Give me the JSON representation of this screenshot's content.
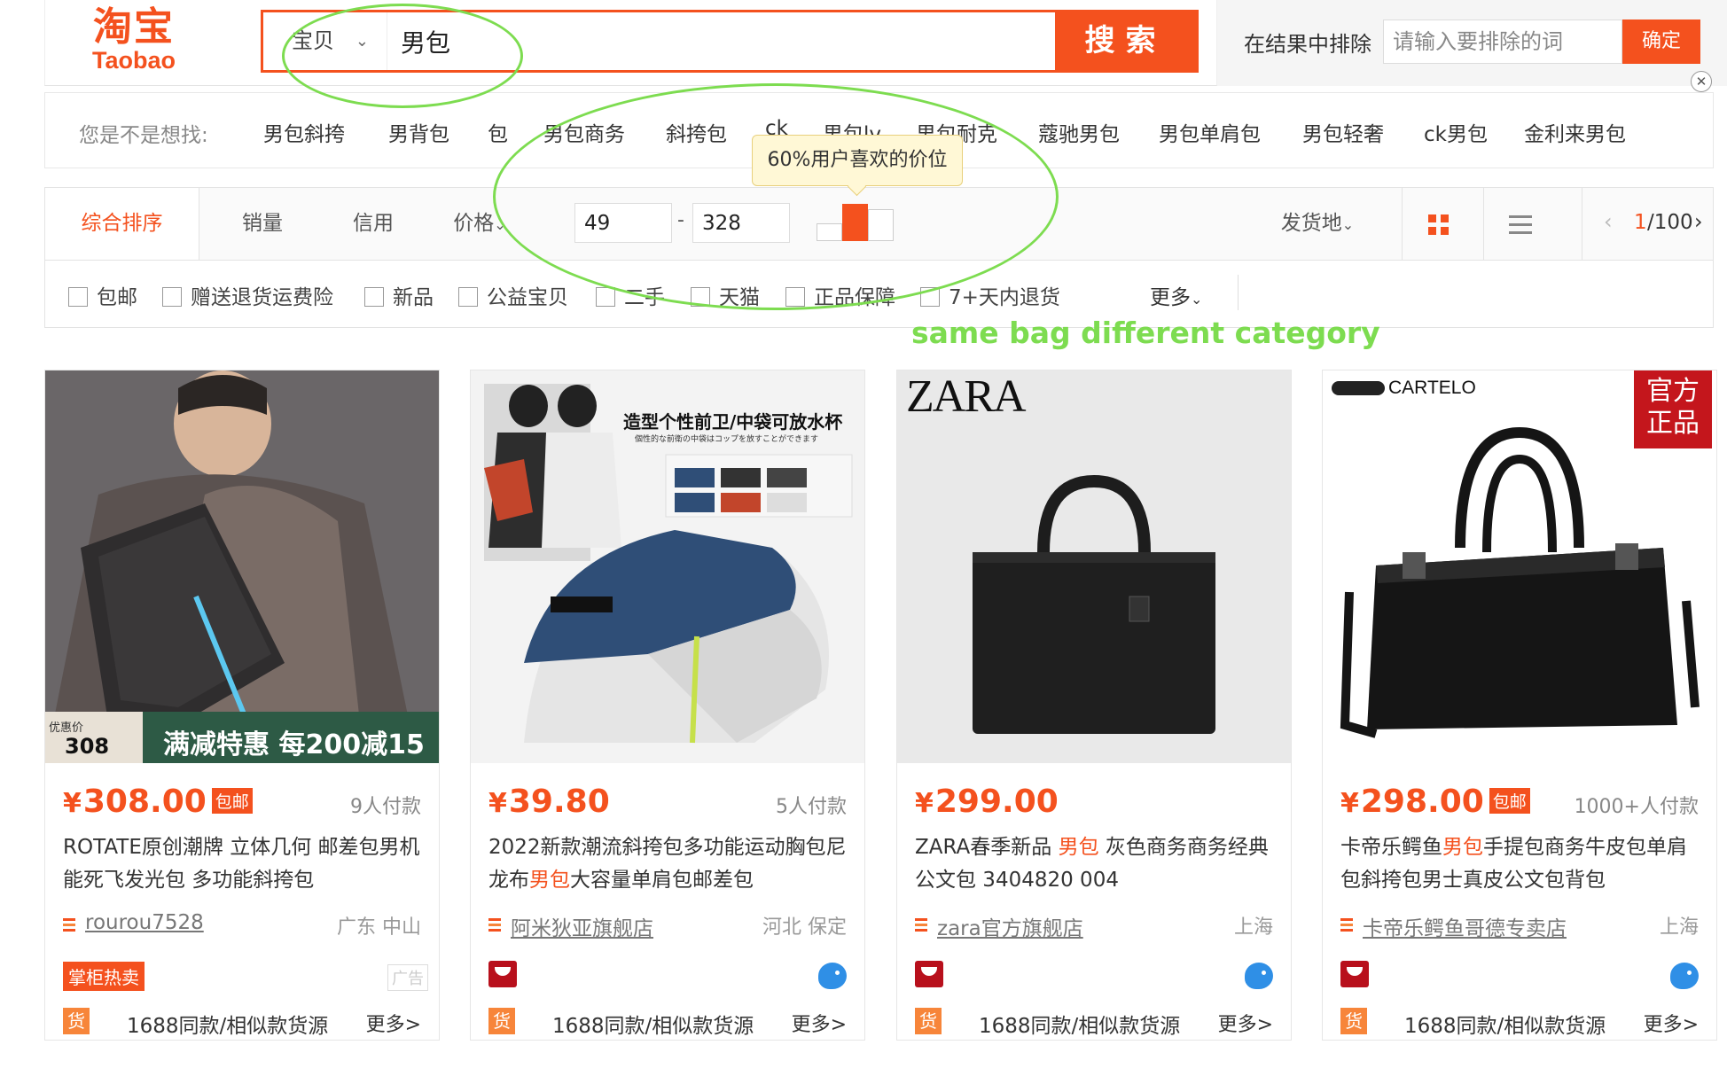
{
  "logo": {
    "cn": "淘宝",
    "en": "Taobao"
  },
  "search": {
    "category": "宝贝",
    "query": "男包",
    "button": "搜索"
  },
  "exclude": {
    "label": "在结果中排除",
    "placeholder": "请输入要排除的词",
    "confirm": "确定"
  },
  "close_icon": "close-icon",
  "suggest": {
    "label": "您是不是想找:",
    "items": [
      "男包斜挎",
      "男背包",
      "包",
      "男包商务",
      "斜挎包",
      "ck",
      "男包lv",
      "男包耐克",
      "蔻驰男包",
      "男包单肩包",
      "男包轻奢",
      "ck男包",
      "金利来男包"
    ]
  },
  "tooltip": "60%用户喜欢的价位",
  "sort": {
    "active": "综合排序",
    "sales": "销量",
    "credit": "信用",
    "price": "价格",
    "price_min": "49",
    "price_max": "328",
    "price_dash": "-",
    "ship_from": "发货地",
    "page_current": "1",
    "page_total": "/100"
  },
  "filters": [
    "包邮",
    "赠送退货运费险",
    "新品",
    "公益宝贝",
    "二手",
    "天猫",
    "正品保障",
    "7+天内退货"
  ],
  "more_filter": "更多",
  "annotation": "same bag different category",
  "colors": {
    "accent": "#f4511e",
    "annotation": "#7ddc50",
    "tmall": "#b8101c",
    "source": "#f7853a"
  },
  "cards": [
    {
      "price": "308.00",
      "baoyou": "包邮",
      "sales": "9人付款",
      "title_a": "ROTATE原创潮牌 立体几何 邮差包男机能死飞发光包 多功能斜挎包",
      "title_hl": "",
      "title_b": "",
      "shop": "rourou7528",
      "location": "广东 中山",
      "badge": "掌柜热卖",
      "ad": "广告",
      "promo": {
        "small": "优惠价",
        "price": "308",
        "text": "满减特惠 每200减15"
      },
      "huo": "货",
      "source": "1688同款/相似款货源",
      "more": "更多>"
    },
    {
      "price": "39.80",
      "baoyou": "",
      "sales": "5人付款",
      "title_a": "2022新款潮流斜挎包多功能运动胸包尼龙布",
      "title_hl": "男包",
      "title_b": "大容量单肩包邮差包",
      "shop": "阿米狄亚旗舰店",
      "location": "河北 保定",
      "banner": "造型个性前卫/中袋可放水杯",
      "banner_sub": "個性的な前衛の中袋はコップを放すことができます",
      "huo": "货",
      "source": "1688同款/相似款货源",
      "more": "更多>"
    },
    {
      "price": "299.00",
      "baoyou": "",
      "sales": "",
      "title_a": "ZARA春季新品 ",
      "title_hl": "男包",
      "title_b": " 灰色商务商务经典公文包 3404820 004",
      "shop": "zara官方旗舰店",
      "location": "上海",
      "brand": "ZARA",
      "huo": "货",
      "source": "1688同款/相似款货源",
      "more": "更多>"
    },
    {
      "price": "298.00",
      "baoyou": "包邮",
      "sales": "1000+人付款",
      "title_a": "卡帝乐鳄鱼",
      "title_hl": "男包",
      "title_b": "手提包商务牛皮包单肩包斜挎包男士真皮公文包背包",
      "shop": "卡帝乐鳄鱼哥德专卖店",
      "location": "上海",
      "brand": "CARTELO",
      "official": "官方正品",
      "huo": "货",
      "source": "1688同款/相似款货源",
      "more": "更多>"
    }
  ]
}
